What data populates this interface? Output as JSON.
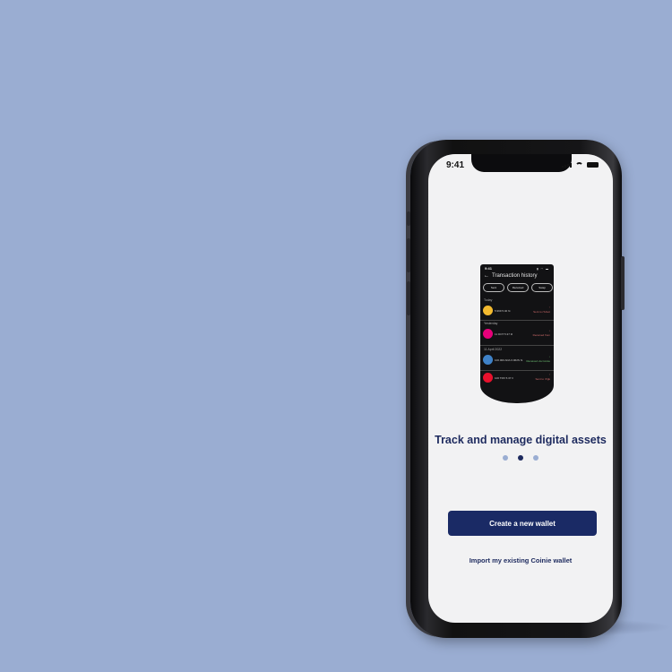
{
  "status": {
    "time": "9:41"
  },
  "preview": {
    "time": "9:41",
    "title": "Transaction history",
    "back_icon": "back-arrow-icon",
    "chips": [
      "Sent",
      "Received",
      "Swap"
    ],
    "sections": [
      "Today",
      "Yesterday",
      "11 April 2022"
    ],
    "transactions": [
      {
        "coin_color": "#f3ba2f",
        "amount": "5.999 5.40 ht",
        "status": "Sent to rSJsot",
        "status_color": "#d06b6b"
      },
      {
        "coin_color": "#e6007a",
        "amount": "11 DOT 5.37 tll",
        "status": "Received from",
        "status_color": "#d06b6b"
      },
      {
        "coin_color": "#3f82c8",
        "amount": "100.000 ADA 6.962S ht",
        "status": "Received via Coinie",
        "status_color": "#6fbf73"
      },
      {
        "coin_color": "#e8112d",
        "amount": "100 TRX 5.37 ll",
        "status": "Sent to rXgk",
        "status_color": "#d06b6b"
      }
    ]
  },
  "onboarding": {
    "heading": "Track and manage digital assets",
    "page_count": 3,
    "active_page": 2
  },
  "actions": {
    "create_label": "Create a new wallet",
    "import_label": "Import my existing Coinie wallet"
  },
  "colors": {
    "background": "#9aadd2",
    "accent": "#1a2a65"
  }
}
